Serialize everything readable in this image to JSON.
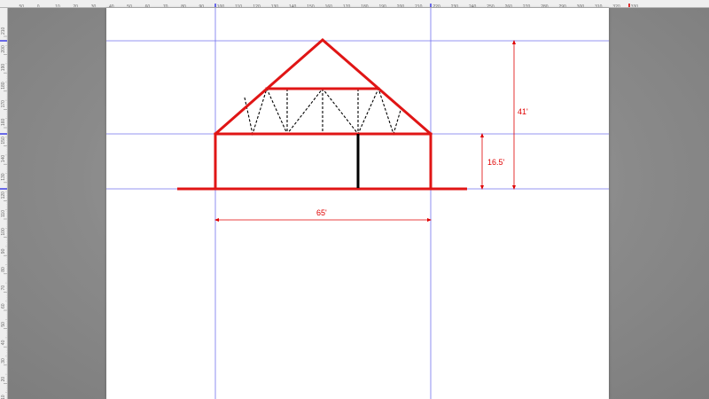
{
  "dimensions": {
    "total_height": "41'",
    "wall_height": "16.5'",
    "width": "65'"
  },
  "top_ruler": {
    "labels": [
      "50",
      "0",
      "10",
      "20",
      "30",
      "40",
      "50",
      "60",
      "70",
      "80",
      "90",
      "100",
      "110",
      "120",
      "130",
      "140",
      "150",
      "160",
      "170",
      "180",
      "190",
      "200",
      "210",
      "220",
      "230",
      "240",
      "250",
      "260",
      "270",
      "280",
      "290",
      "300",
      "310",
      "320",
      "330"
    ]
  },
  "left_ruler": {
    "labels": [
      "210",
      "200",
      "190",
      "180",
      "170",
      "160",
      "150",
      "140",
      "130",
      "120",
      "110",
      "100",
      "90",
      "80",
      "70",
      "60",
      "50",
      "40",
      "30",
      "20",
      "10"
    ]
  },
  "colors": {
    "structure": "#e01515",
    "guide": "#7070ee",
    "dimension": "#e00000",
    "post": "#000000",
    "dashed_web": "#000000"
  },
  "icons": [
    "ruler-marker-icon"
  ]
}
